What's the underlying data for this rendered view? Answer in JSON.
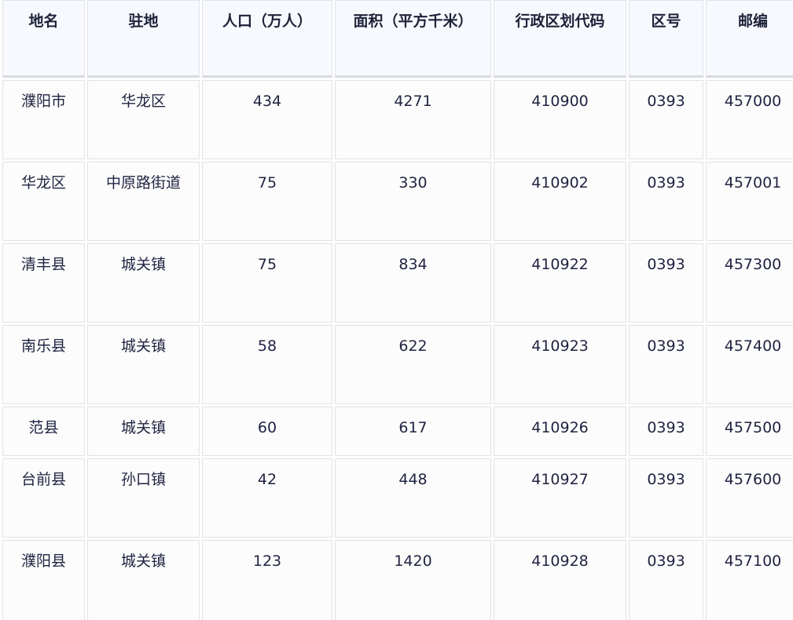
{
  "table": {
    "headers": [
      "地名",
      "驻地",
      "人口（万人）",
      "面积（平方千米）",
      "行政区划代码",
      "区号",
      "邮编"
    ],
    "rows": [
      [
        "濮阳市",
        "华龙区",
        "434",
        "4271",
        "410900",
        "0393",
        "457000"
      ],
      [
        "华龙区",
        "中原路街道",
        "75",
        "330",
        "410902",
        "0393",
        "457001"
      ],
      [
        "清丰县",
        "城关镇",
        "75",
        "834",
        "410922",
        "0393",
        "457300"
      ],
      [
        "南乐县",
        "城关镇",
        "58",
        "622",
        "410923",
        "0393",
        "457400"
      ],
      [
        "范县",
        "城关镇",
        "60",
        "617",
        "410926",
        "0393",
        "457500"
      ],
      [
        "台前县",
        "孙口镇",
        "42",
        "448",
        "410927",
        "0393",
        "457600"
      ],
      [
        "濮阳县",
        "城关镇",
        "123",
        "1420",
        "410928",
        "0393",
        "457100"
      ]
    ]
  }
}
